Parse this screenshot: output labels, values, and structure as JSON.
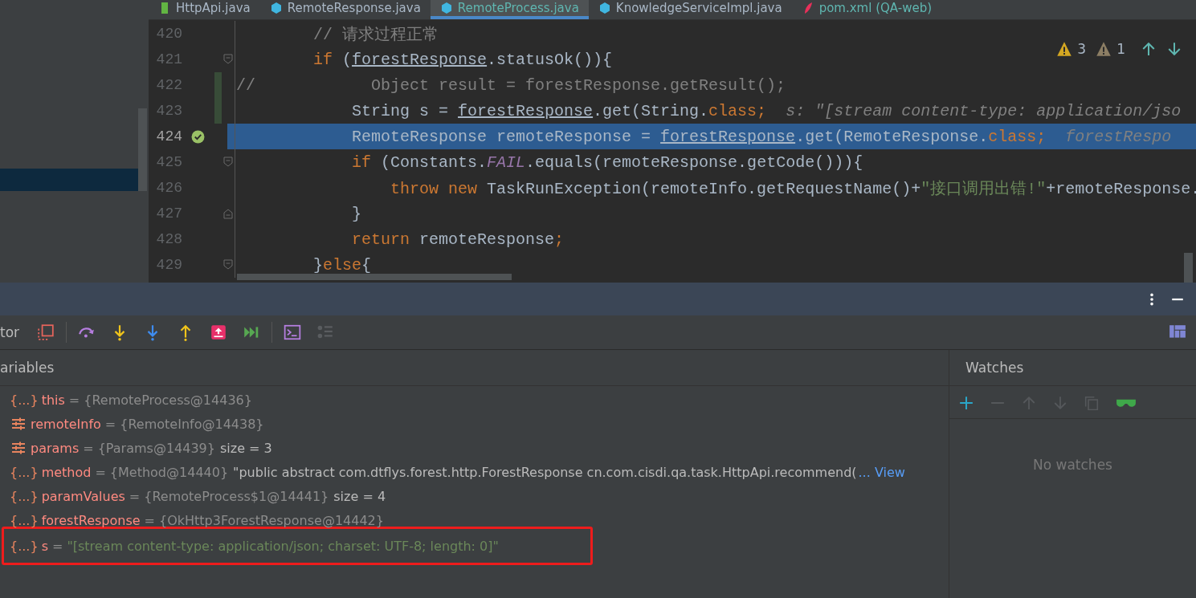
{
  "editor_tabs": [
    {
      "label": "HttpApi.java",
      "kind": "interface",
      "selected": false
    },
    {
      "label": "RemoteResponse.java",
      "kind": "class",
      "selected": false
    },
    {
      "label": "RemoteProcess.java",
      "kind": "class",
      "selected": true
    },
    {
      "label": "KnowledgeServiceImpl.java",
      "kind": "class",
      "selected": false
    },
    {
      "label": "pom.xml (QA-web)",
      "kind": "maven",
      "selected": false
    }
  ],
  "inspections": {
    "warnings": "3",
    "weak_warnings": "1"
  },
  "code_lines": [
    {
      "number": "420",
      "fold_start": false,
      "fold_end": false,
      "changed": false,
      "breakpoint": false,
      "selected": false,
      "tokens": [
        {
          "t": "        // 请求过程正常",
          "kind": "comment"
        }
      ]
    },
    {
      "number": "421",
      "fold_start": true,
      "fold_end": false,
      "changed": false,
      "breakpoint": false,
      "selected": false,
      "tokens": [
        {
          "t": "        if",
          "kind": "keyword"
        },
        {
          "t": " (",
          "kind": "plain"
        },
        {
          "t": "forestResponse",
          "kind": "ref"
        },
        {
          "t": ".statusOk()){",
          "kind": "plain"
        }
      ]
    },
    {
      "number": "422",
      "fold_start": false,
      "fold_end": false,
      "changed": true,
      "breakpoint": false,
      "selected": false,
      "tokens": [
        {
          "t": "//            Object result = forestResponse.getResult();",
          "kind": "comment"
        }
      ]
    },
    {
      "number": "423",
      "fold_start": false,
      "fold_end": false,
      "changed": true,
      "breakpoint": false,
      "selected": false,
      "tokens": [
        {
          "t": "            String s = ",
          "kind": "plain"
        },
        {
          "t": "forestResponse",
          "kind": "ref"
        },
        {
          "t": ".get(String.",
          "kind": "plain"
        },
        {
          "t": "class;",
          "kind": "keyword"
        },
        {
          "t": "  s: \"[stream content-type: application/jso",
          "kind": "hint"
        }
      ]
    },
    {
      "number": "424",
      "fold_start": false,
      "fold_end": false,
      "changed": false,
      "breakpoint": true,
      "selected": true,
      "tokens": [
        {
          "t": "            RemoteResponse remoteResponse = ",
          "kind": "plain"
        },
        {
          "t": "forestResponse",
          "kind": "ref"
        },
        {
          "t": ".get(RemoteResponse.",
          "kind": "plain"
        },
        {
          "t": "class;",
          "kind": "keyword"
        },
        {
          "t": "  forestRespo",
          "kind": "hint"
        }
      ]
    },
    {
      "number": "425",
      "fold_start": true,
      "fold_end": false,
      "changed": false,
      "breakpoint": false,
      "selected": false,
      "tokens": [
        {
          "t": "            if",
          "kind": "keyword"
        },
        {
          "t": " (Constants.",
          "kind": "plain"
        },
        {
          "t": "FAIL",
          "kind": "constant"
        },
        {
          "t": ".equals(remoteResponse.getCode())){",
          "kind": "plain"
        }
      ]
    },
    {
      "number": "426",
      "fold_start": false,
      "fold_end": false,
      "changed": false,
      "breakpoint": false,
      "selected": false,
      "tokens": [
        {
          "t": "                throw new",
          "kind": "keyword"
        },
        {
          "t": " TaskRunException(remoteInfo.getRequestName()+",
          "kind": "plain"
        },
        {
          "t": "\"接口调用出错!\"",
          "kind": "string"
        },
        {
          "t": "+remoteResponse.",
          "kind": "plain"
        }
      ]
    },
    {
      "number": "427",
      "fold_start": false,
      "fold_end": true,
      "changed": false,
      "breakpoint": false,
      "selected": false,
      "tokens": [
        {
          "t": "            }",
          "kind": "plain"
        }
      ]
    },
    {
      "number": "428",
      "fold_start": false,
      "fold_end": false,
      "changed": false,
      "breakpoint": false,
      "selected": false,
      "tokens": [
        {
          "t": "            return",
          "kind": "keyword"
        },
        {
          "t": " remoteResponse",
          "kind": "plain"
        },
        {
          "t": ";",
          "kind": "keyword"
        }
      ]
    },
    {
      "number": "429",
      "fold_start": true,
      "fold_end": false,
      "changed": false,
      "breakpoint": false,
      "selected": false,
      "tokens": [
        {
          "t": "        }",
          "kind": "plain"
        },
        {
          "t": "else",
          "kind": "keyword"
        },
        {
          "t": "{",
          "kind": "plain"
        }
      ]
    }
  ],
  "debugger": {
    "tab_label": "tor",
    "variables_title": "ariables",
    "watches_title": "Watches",
    "watches_empty": "No watches",
    "variables": [
      {
        "kind": "object",
        "icon": "{...}",
        "name": "this",
        "eq": "=",
        "value": "{RemoteProcess@14436}",
        "highlighted": false
      },
      {
        "kind": "fields",
        "name": "remoteInfo",
        "eq": "=",
        "value": "{RemoteInfo@14438}",
        "highlighted": false
      },
      {
        "kind": "fields",
        "name": "params",
        "eq": "=",
        "value": "{Params@14439}",
        "extra": "size = 3",
        "highlighted": false
      },
      {
        "kind": "object",
        "icon": "{...}",
        "name": "method",
        "eq": "=",
        "value": "{Method@14440}",
        "extra": "\"public abstract com.dtflys.forest.http.ForestResponse cn.com.cisdi.qa.task.HttpApi.recommend(",
        "link": "... View",
        "highlighted": false
      },
      {
        "kind": "object",
        "icon": "{...}",
        "name": "paramValues",
        "eq": "=",
        "value": "{RemoteProcess$1@14441}",
        "extra": "size = 4",
        "highlighted": false
      },
      {
        "kind": "object",
        "icon": "{...}",
        "name": "forestResponse",
        "eq": "=",
        "value": "{OkHttp3ForestResponse@14442}",
        "highlighted": false
      },
      {
        "kind": "object",
        "icon": "{...}",
        "name": "s",
        "eq": "=",
        "string": "\"[stream content-type: application/json; charset: UTF-8; length: 0]\"",
        "highlighted": true
      }
    ]
  }
}
